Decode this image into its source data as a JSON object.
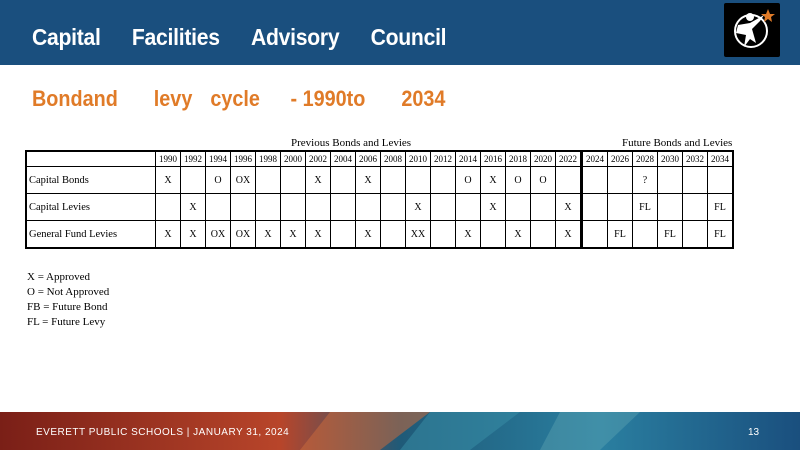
{
  "header": {
    "title_words": [
      "Capital",
      "Facilities",
      "Advisory",
      "Council"
    ]
  },
  "subtitle": {
    "words": [
      "Bondand",
      "levy",
      "cycle",
      "- 1990to",
      "2034"
    ]
  },
  "table": {
    "previous_label": "Previous Bonds and Levies",
    "future_label": "Future Bonds and Levies",
    "years": [
      "1990",
      "1992",
      "1994",
      "1996",
      "1998",
      "2000",
      "2002",
      "2004",
      "2006",
      "2008",
      "2010",
      "2012",
      "2014",
      "2016",
      "2018",
      "2020",
      "2022",
      "2024",
      "2026",
      "2028",
      "2030",
      "2032",
      "2034"
    ],
    "rows": [
      {
        "label": "Capital Bonds",
        "cells": [
          "X",
          "",
          "O",
          "OX",
          "",
          "",
          "X",
          "",
          "X",
          "",
          "",
          "",
          "O",
          "X",
          "O",
          "O",
          "",
          "",
          "",
          "?",
          "",
          "",
          ""
        ]
      },
      {
        "label": "Capital Levies",
        "cells": [
          "",
          "X",
          "",
          "",
          "",
          "",
          "",
          "",
          "",
          "",
          "X",
          "",
          "",
          "X",
          "",
          "",
          "X",
          "",
          "",
          "FL",
          "",
          "",
          "FL"
        ]
      },
      {
        "label": "General Fund Levies",
        "cells": [
          "X",
          "X",
          "OX",
          "OX",
          "X",
          "X",
          "X",
          "",
          "X",
          "",
          "XX",
          "",
          "X",
          "",
          "X",
          "",
          "X",
          "",
          "FL",
          "",
          "FL",
          "",
          "FL"
        ]
      }
    ]
  },
  "legend": [
    "X = Approved",
    "O = Not Approved",
    "FB = Future Bond",
    "FL = Future Levy"
  ],
  "footer": {
    "text": "EVERETT  PUBLIC  SCHOOLS   |   JANUARY  31, 2024",
    "page": "13"
  },
  "colors": {
    "header_bg": "#1a4f7e",
    "subtitle": "#e07b28",
    "footer_dark": "#7a1f17"
  }
}
